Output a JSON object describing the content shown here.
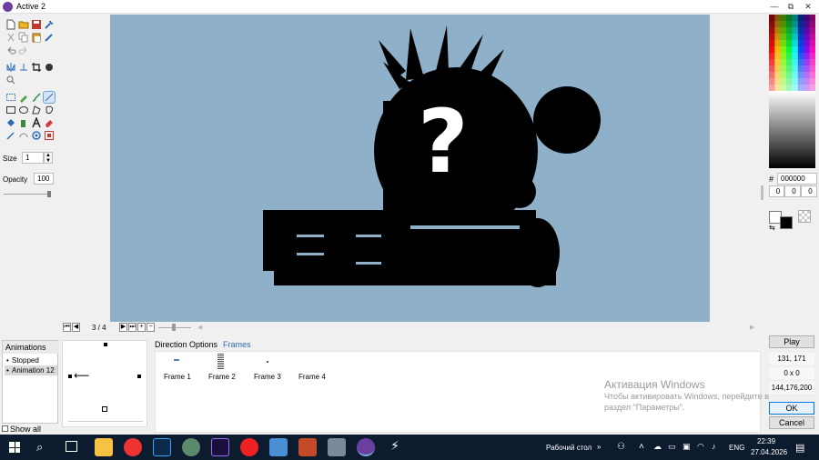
{
  "window": {
    "title": "Active 2",
    "controls": [
      "—",
      "⧉",
      "✕"
    ]
  },
  "toolbox": {
    "size_label": "Size",
    "size_value": "1",
    "opacity_label": "Opacity",
    "opacity_value": "100",
    "opacity_level": 1.0
  },
  "canvas": {
    "background_color": "#8eb0c9",
    "glyph": "?"
  },
  "color": {
    "hash_label": "#",
    "hex_value": "000000",
    "r": "0",
    "g": "0",
    "b": "0",
    "foreground": "#ffffff",
    "background": "#000000"
  },
  "timeline": {
    "frame_counter": "3 / 4"
  },
  "animations": {
    "header": "Animations",
    "items": [
      "Stopped",
      "Animation 12"
    ],
    "show_all_label": "Show all"
  },
  "frames_panel": {
    "tabs": [
      "Direction Options",
      "Frames"
    ],
    "frames": [
      "Frame 1",
      "Frame 2",
      "Frame 3",
      "Frame 4"
    ]
  },
  "right_panel": {
    "play_label": "Play",
    "coords": "131, 171",
    "selection_size": "0 x 0",
    "pixel_rgb": "144,176,200",
    "ok_label": "OK",
    "cancel_label": "Cancel"
  },
  "watermark": {
    "title": "Активация Windows",
    "line1": "Чтобы активировать Windows, перейдите в",
    "line2": "раздел \"Параметры\"."
  },
  "taskbar": {
    "desktop_label": "Рабочий стол",
    "lang": "ENG",
    "time": "22:39",
    "date": "27.04.2026",
    "apps": [
      "file-explorer-icon",
      "yandex-icon",
      "photoshop-icon",
      "browser-icon",
      "animate-icon",
      "yandex-browser-icon",
      "messenger-icon",
      "archive-icon",
      "network-icon",
      "clickteam-icon",
      "zap-icon"
    ]
  }
}
